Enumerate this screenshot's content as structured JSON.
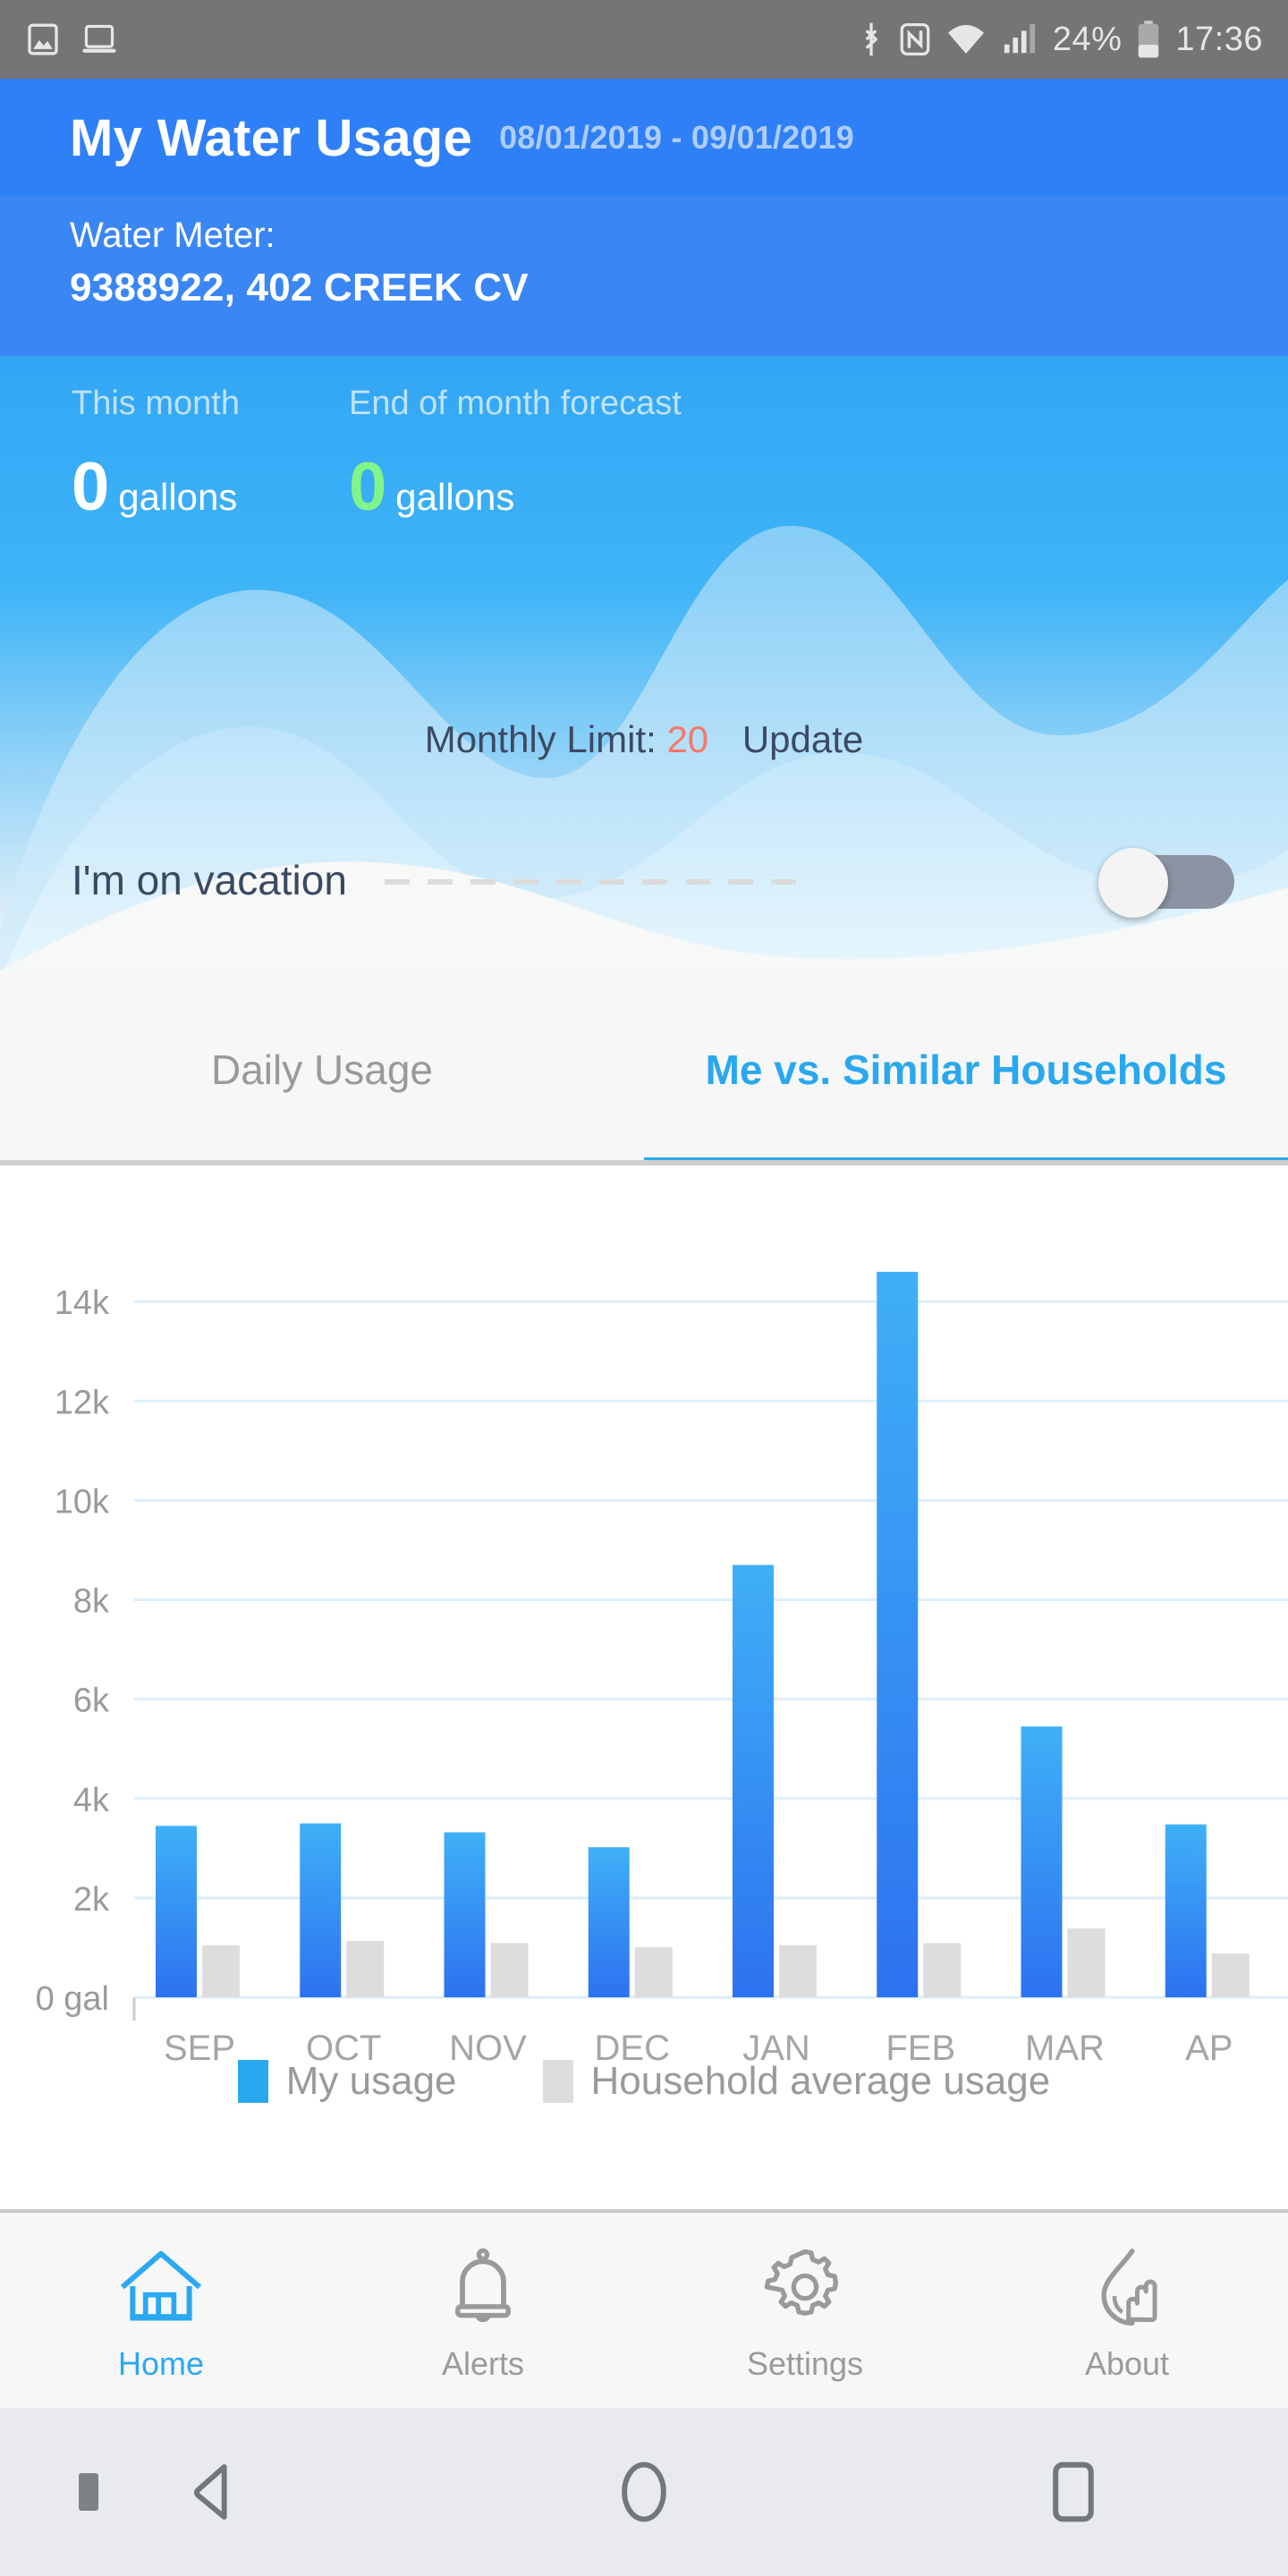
{
  "status_bar": {
    "left_icons": [
      "image-icon",
      "laptop-icon"
    ],
    "right_icons": [
      "bluetooth-icon",
      "nfc-icon",
      "wifi-icon",
      "signal-icon",
      "battery-icon"
    ],
    "battery_percent": "24%",
    "time": "17:36"
  },
  "app_bar": {
    "title": "My Water Usage",
    "date_range": "08/01/2019 - 09/01/2019"
  },
  "meter": {
    "label": "Water Meter:",
    "value": "9388922, 402 CREEK CV"
  },
  "hero": {
    "this_month_label": "This month",
    "this_month_value": "0",
    "this_month_unit": "gallons",
    "forecast_label": "End of month forecast",
    "forecast_value": "0",
    "forecast_unit": "gallons",
    "forecast_color": "#82f58a",
    "monthly_limit_label": "Monthly Limit:",
    "monthly_limit_value": "20",
    "monthly_limit_color": "#f9766a",
    "update_label": "Update"
  },
  "vacation": {
    "label": "I'm on vacation",
    "toggle_state": "off"
  },
  "tabs": [
    {
      "label": "Daily Usage",
      "active": false
    },
    {
      "label": "Me vs. Similar Households",
      "active": true
    }
  ],
  "chart_data": {
    "type": "bar",
    "title": "",
    "xlabel": "",
    "ylabel": "",
    "categories": [
      "SEP",
      "OCT",
      "NOV",
      "DEC",
      "JAN",
      "FEB",
      "MAR",
      "AP"
    ],
    "series": [
      {
        "name": "My usage",
        "color": "#2e86f7",
        "values": [
          3450,
          3500,
          3320,
          3020,
          8700,
          14600,
          5450,
          3480
        ]
      },
      {
        "name": "Household average usage",
        "color": "#dddddd",
        "values": [
          250,
          270,
          260,
          240,
          250,
          260,
          330,
          210
        ]
      }
    ],
    "ytick_labels": [
      "14k",
      "12k",
      "10k",
      "8k",
      "6k",
      "4k",
      "2k",
      "0 gal"
    ],
    "ytick_values": [
      14000,
      12000,
      10000,
      8000,
      6000,
      4000,
      2000,
      0
    ],
    "ylim": [
      0,
      15300
    ],
    "grid": true,
    "grid_color": "#dceefb",
    "legend_position": "bottom",
    "legend": [
      "My usage",
      "Household average usage"
    ],
    "last_category_clipped": true
  },
  "bottom_nav": [
    {
      "label": "Home",
      "icon": "home-icon",
      "active": true
    },
    {
      "label": "Alerts",
      "icon": "bell-icon",
      "active": false
    },
    {
      "label": "Settings",
      "icon": "gear-icon",
      "active": false
    },
    {
      "label": "About",
      "icon": "water-drop-hand-icon",
      "active": false
    }
  ],
  "system_nav": {
    "back": "back-triangle-icon",
    "home": "home-circle-icon",
    "recents": "recents-square-icon"
  }
}
